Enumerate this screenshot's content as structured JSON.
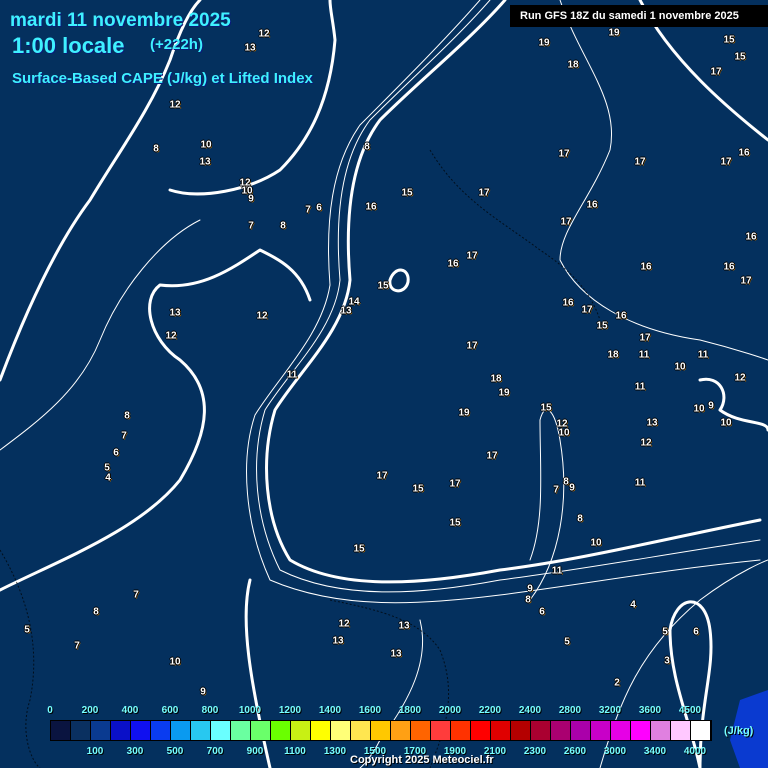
{
  "header": {
    "date": "mardi 11 novembre 2025",
    "time": "1:00 locale",
    "lead": "(+222h)",
    "parameter": "Surface-Based CAPE (J/kg) et Lifted Index",
    "run": "Run GFS 18Z du samedi 1 novembre 2025"
  },
  "legend": {
    "unit": "(J/kg)",
    "top_labels": [
      "0",
      "200",
      "400",
      "600",
      "800",
      "1000",
      "1200",
      "1400",
      "1600",
      "1800",
      "2000",
      "2200",
      "2400",
      "2800",
      "3200",
      "3600",
      "4500"
    ],
    "bottom_labels": [
      "100",
      "300",
      "500",
      "700",
      "900",
      "1100",
      "1300",
      "1500",
      "1700",
      "1900",
      "2100",
      "2300",
      "2600",
      "3000",
      "3400",
      "4000"
    ],
    "colors": [
      "#0a1440",
      "#0a3060",
      "#0a3a90",
      "#0a10c8",
      "#1010f0",
      "#0a3cf0",
      "#0a9af0",
      "#28c8f0",
      "#6affff",
      "#6affa0",
      "#6aff6a",
      "#6aff00",
      "#c8f014",
      "#ffff00",
      "#ffff78",
      "#ffe650",
      "#ffc800",
      "#ffa014",
      "#ff6400",
      "#ff3c3c",
      "#ff3200",
      "#ff0000",
      "#e00000",
      "#b40000",
      "#aa0030",
      "#aa0070",
      "#aa00aa",
      "#c800c8",
      "#e600e6",
      "#ff00ff",
      "#e080e0",
      "#ffc8ff",
      "#ffffff"
    ]
  },
  "map": {
    "lifted_index_labels": [
      "12",
      "13",
      "15",
      "19",
      "19",
      "15",
      "18",
      "17",
      "12",
      "10",
      "8",
      "13",
      "8",
      "17",
      "17",
      "17",
      "16",
      "12",
      "10",
      "9",
      "15",
      "17",
      "16",
      "7",
      "6",
      "16",
      "17",
      "7",
      "8",
      "16",
      "16",
      "17",
      "16",
      "16",
      "17",
      "15",
      "13",
      "12",
      "14",
      "13",
      "16",
      "17",
      "15",
      "16",
      "12",
      "17",
      "17",
      "18",
      "11",
      "11",
      "18",
      "11",
      "10",
      "12",
      "11",
      "19",
      "8",
      "15",
      "19",
      "10",
      "9",
      "7",
      "12",
      "10",
      "13",
      "10",
      "6",
      "12",
      "5",
      "4",
      "17",
      "17",
      "17",
      "15",
      "7",
      "8",
      "9",
      "11",
      "15",
      "8",
      "15",
      "10",
      "11",
      "9",
      "8",
      "7",
      "8",
      "6",
      "4",
      "12",
      "13",
      "5",
      "5",
      "6",
      "13",
      "7",
      "5",
      "13",
      "10",
      "3",
      "9",
      "2"
    ]
  },
  "footer": {
    "copyright": "Copyright 2025 Meteociel.fr"
  }
}
